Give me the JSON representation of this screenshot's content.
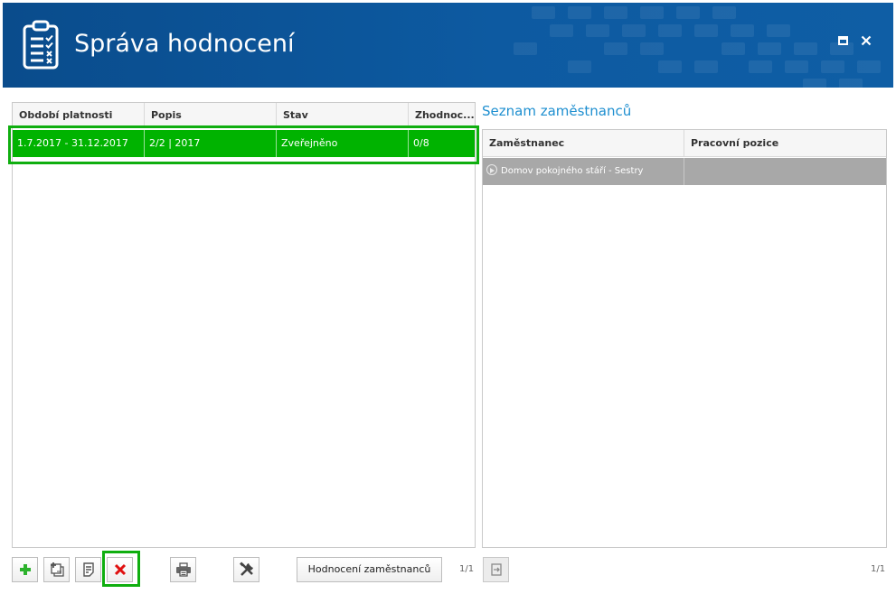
{
  "window": {
    "title": "Správa hodnocení"
  },
  "colors": {
    "header": "#0d5aa1",
    "selected_row": "#00b300",
    "highlight_outline": "#0fae0f",
    "accent_text": "#1e8fd0",
    "delete_red": "#e01010",
    "add_green": "#2db22d"
  },
  "left_grid": {
    "columns": [
      "Období platnosti",
      "Popis",
      "Stav",
      "Zhodnoc..."
    ],
    "rows": [
      {
        "period": "1.7.2017 - 31.12.2017",
        "description": "2/2 | 2017",
        "status": "Zveřejněno",
        "evaluated": "0/8"
      }
    ]
  },
  "right_panel": {
    "title": "Seznam zaměstnanců",
    "columns": [
      "Zaměstnanec",
      "Pracovní pozice"
    ],
    "rows": [
      {
        "employee": "Domov pokojného stáří - Sestry",
        "position": ""
      }
    ]
  },
  "toolbar": {
    "icons": [
      "add-icon",
      "copy-add-icon",
      "edit-icon",
      "delete-icon",
      "print-icon",
      "tools-icon"
    ],
    "evaluate_button_label": "Hodnocení zaměstnanců",
    "left_pager": "1/1",
    "right_pager": "1/1",
    "export_icon": "export-icon"
  }
}
